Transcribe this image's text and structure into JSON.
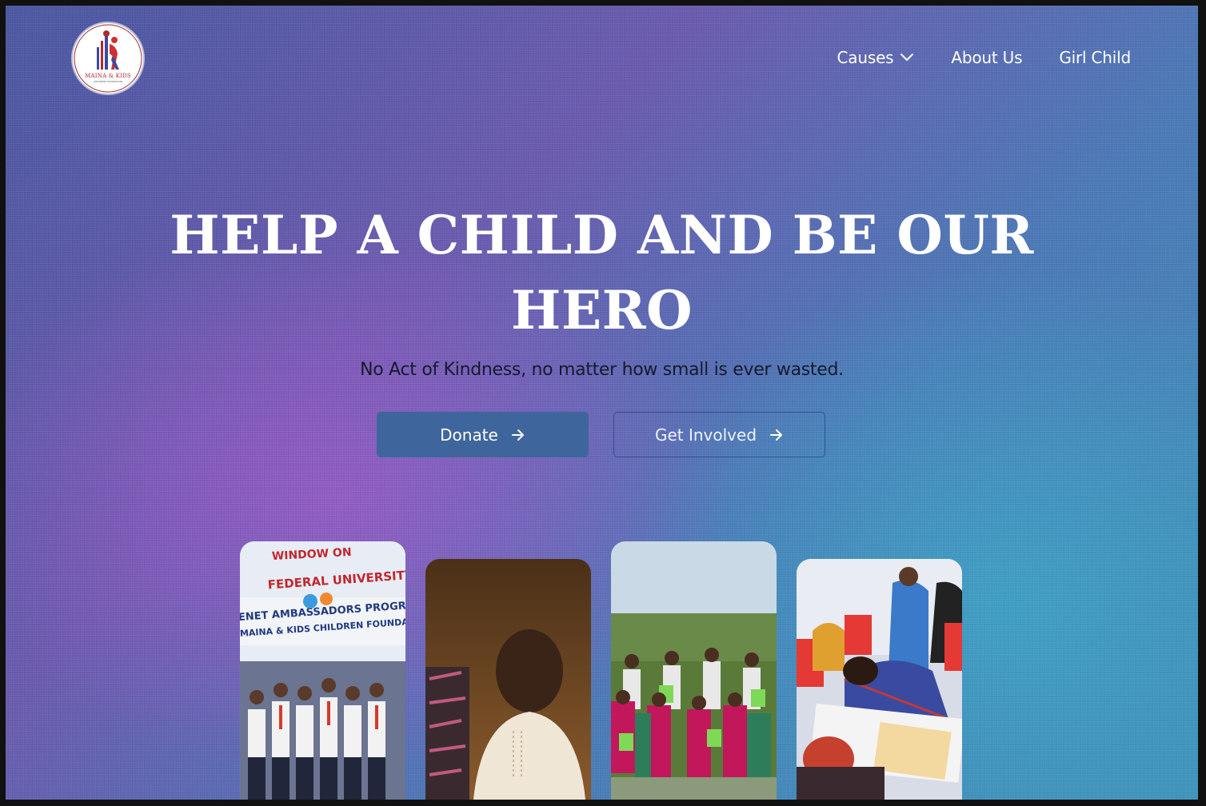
{
  "logo": {
    "name": "MAINA & KIDS",
    "tagline": "CHILDREN FOUNDATION"
  },
  "nav": {
    "items": [
      {
        "label": "Causes",
        "has_dropdown": true
      },
      {
        "label": "About Us",
        "has_dropdown": false
      },
      {
        "label": "Girl Child",
        "has_dropdown": false
      }
    ]
  },
  "hero": {
    "title": "HELP A CHILD AND BE OUR HERO",
    "subtitle": "No Act of Kindness, no matter how small is ever wasted.",
    "donate_label": "Donate",
    "involved_label": "Get Involved"
  },
  "gallery": {
    "banner_line1": "WINDOW ON",
    "banner_line2": "FEDERAL UNIVERSITY",
    "banner_line3": "ENET AMBASSADORS PROGRAM",
    "banner_line4": "MAINA & KIDS CHILDREN FOUNDATION"
  },
  "colors": {
    "donate_bg": "#3f669c",
    "title": "#ffffff",
    "subtitle": "#161a2e",
    "logo_accent": "#b02a2a"
  }
}
